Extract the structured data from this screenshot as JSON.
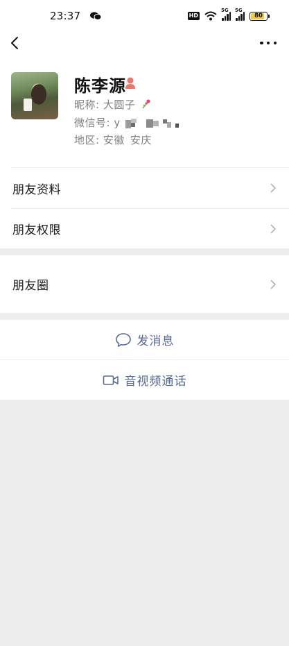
{
  "status_bar": {
    "time": "23:37",
    "hd_label": "HD",
    "sim1_label": "5G",
    "sim2_label": "5G",
    "battery_level": "80"
  },
  "profile": {
    "name": "陈李源",
    "nickname_label": "昵称:",
    "nickname_value": "大圆子",
    "wechat_id_label": "微信号:",
    "wechat_id_value": "y",
    "region_label": "地区:",
    "region_province": "安徽",
    "region_city": "安庆"
  },
  "menu": {
    "friend_info": "朋友资料",
    "friend_permissions": "朋友权限",
    "moments": "朋友圈"
  },
  "actions": {
    "send_message": "发消息",
    "video_call": "音视频通话"
  },
  "colors": {
    "link_blue": "#576b95",
    "gender_female": "#e8776f",
    "page_background": "#ededed"
  }
}
